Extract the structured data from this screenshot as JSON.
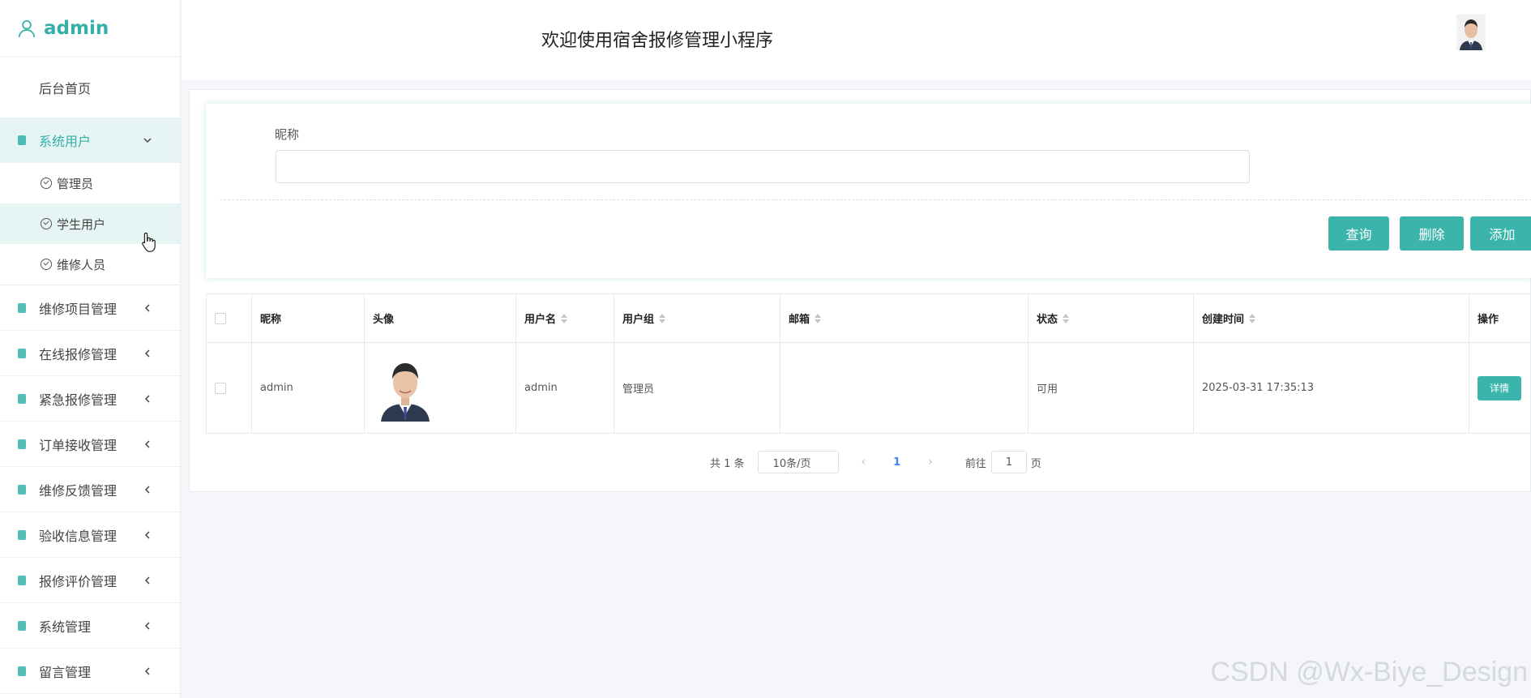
{
  "app": {
    "user_name": "admin",
    "page_title": "欢迎使用宿舍报修管理小程序"
  },
  "sidebar": {
    "home": "后台首页",
    "active_group": {
      "label": "系统用户",
      "items": [
        "管理员",
        "学生用户",
        "维修人员"
      ]
    },
    "groups": [
      "维修项目管理",
      "在线报修管理",
      "紧急报修管理",
      "订单接收管理",
      "维修反馈管理",
      "验收信息管理",
      "报修评价管理",
      "系统管理",
      "留言管理"
    ]
  },
  "search": {
    "label": "昵称",
    "value": "",
    "buttons": {
      "query": "查询",
      "delete": "删除",
      "add": "添加"
    }
  },
  "table": {
    "headers": [
      "昵称",
      "头像",
      "用户名",
      "用户组",
      "邮箱",
      "状态",
      "创建时间",
      "操作"
    ],
    "rows": [
      {
        "nickname": "admin",
        "username": "admin",
        "group": "管理员",
        "email": "",
        "status": "可用",
        "created": "2025-03-31 17:35:13",
        "action": "详情"
      }
    ]
  },
  "pagination": {
    "total": "共 1 条",
    "page_size": "10条/页",
    "current_page": "1",
    "goto_label": "前往",
    "goto_value": "1",
    "page_unit": "页"
  },
  "watermark": "CSDN @Wx-Biye_Design",
  "colors": {
    "accent": "#3bb5ac",
    "active_bg": "#e6f5f3"
  }
}
